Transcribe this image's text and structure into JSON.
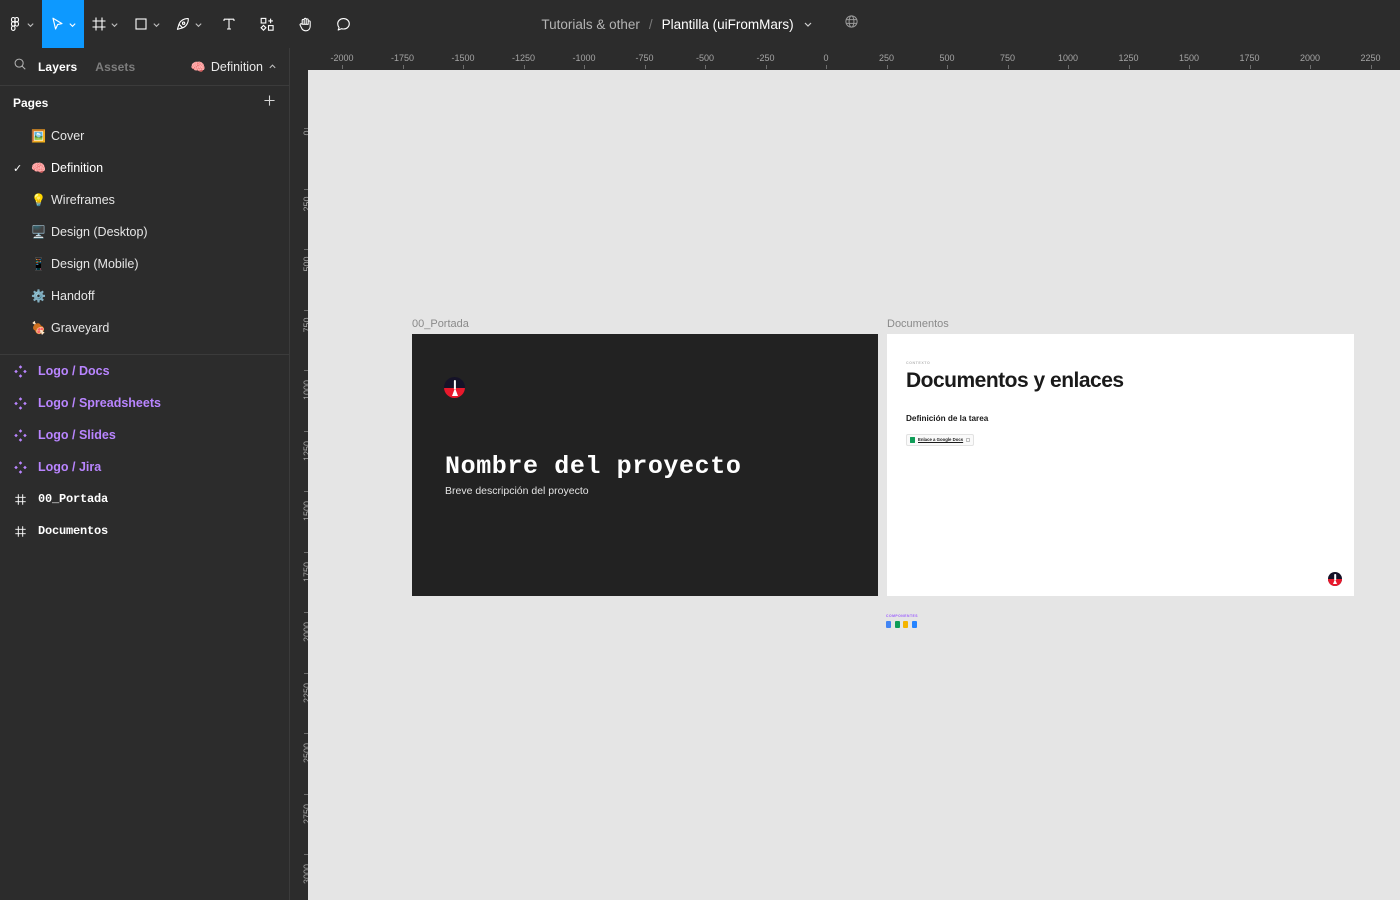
{
  "app": {
    "name": "Figma"
  },
  "toolbar": {
    "tools": [
      {
        "name": "figma-menu-icon",
        "label": "Main menu",
        "caret": true,
        "active": false
      },
      {
        "name": "move-tool-icon",
        "label": "Move",
        "caret": true,
        "active": true
      },
      {
        "name": "frame-tool-icon",
        "label": "Frame",
        "caret": true,
        "active": false
      },
      {
        "name": "shape-tool-icon",
        "label": "Shape",
        "caret": true,
        "active": false
      },
      {
        "name": "pen-tool-icon",
        "label": "Pen",
        "caret": true,
        "active": false
      },
      {
        "name": "text-tool-icon",
        "label": "Text",
        "caret": false,
        "active": false
      },
      {
        "name": "resources-tool-icon",
        "label": "Resources",
        "caret": false,
        "active": false
      },
      {
        "name": "hand-tool-icon",
        "label": "Hand",
        "caret": false,
        "active": false
      },
      {
        "name": "comment-tool-icon",
        "label": "Comment",
        "caret": false,
        "active": false
      }
    ],
    "breadcrumb_parent": "Tutorials & other",
    "breadcrumb_separator": "/",
    "file_name": "Plantilla (uiFromMars)",
    "globe_icon": "globe-icon",
    "accent_color": "#0d99ff"
  },
  "sidebar": {
    "search_icon": "search-icon",
    "tabs": [
      {
        "label": "Layers",
        "active": true
      },
      {
        "label": "Assets",
        "active": false
      }
    ],
    "page_selector": {
      "emoji": "🧠",
      "label": "Definition",
      "caret_icon": "chevron-up-icon"
    },
    "pages_header": {
      "label": "Pages",
      "add_icon": "plus-icon"
    },
    "pages": [
      {
        "emoji": "🖼️",
        "label": "Cover",
        "selected": false
      },
      {
        "emoji": "🧠",
        "label": "Definition",
        "selected": true
      },
      {
        "emoji": "💡",
        "label": "Wireframes",
        "selected": false
      },
      {
        "emoji": "🖥️",
        "label": "Design (Desktop)",
        "selected": false
      },
      {
        "emoji": "📱",
        "label": "Design (Mobile)",
        "selected": false
      },
      {
        "emoji": "⚙️",
        "label": "Handoff",
        "selected": false
      },
      {
        "emoji": "🍖",
        "label": "Graveyard",
        "selected": false
      }
    ],
    "layers": [
      {
        "icon": "component-icon",
        "type": "component",
        "label": "Logo / Docs"
      },
      {
        "icon": "component-icon",
        "type": "component",
        "label": "Logo / Spreadsheets"
      },
      {
        "icon": "component-icon",
        "type": "component",
        "label": "Logo / Slides"
      },
      {
        "icon": "component-icon",
        "type": "component",
        "label": "Logo / Jira"
      },
      {
        "icon": "frame-icon",
        "type": "frame",
        "label": "00_Portada"
      },
      {
        "icon": "frame-icon",
        "type": "frame",
        "label": "Documentos"
      }
    ]
  },
  "rulers": {
    "horizontal": [
      "-2000",
      "-1750",
      "-1500",
      "-1250",
      "-1000",
      "-750",
      "-500",
      "-250",
      "0",
      "250",
      "500",
      "750",
      "1000",
      "1250",
      "1500",
      "1750",
      "2000",
      "2250"
    ],
    "vertical": [
      "0",
      "250",
      "500",
      "750",
      "1000",
      "1250",
      "1500",
      "1750",
      "2000",
      "2250",
      "2500",
      "2750",
      "3000"
    ]
  },
  "canvas": {
    "background_color": "#e5e5e5",
    "frames": [
      {
        "name": "00_Portada",
        "label": "00_Portada",
        "background_color": "#222222",
        "title": "Nombre del proyecto",
        "subtitle": "Breve descripción del proyecto",
        "logo": "project-logo-icon"
      },
      {
        "name": "Documentos",
        "label": "Documentos",
        "background_color": "#ffffff",
        "eyebrow": "CONTEXTO",
        "title": "Documentos y enlaces",
        "section": "Definición de la tarea",
        "link_label": "Enlace a Google Docs",
        "link_icon": "google-docs-icon",
        "copy_icon": "copy-icon",
        "avatar": "project-logo-icon"
      }
    ],
    "mini_cluster": {
      "title": "COMPONENTES",
      "icons": [
        {
          "name": "logo-docs-icon",
          "color": "#4285f4"
        },
        {
          "name": "logo-spreadsheets-icon",
          "color": "#0f9d58"
        },
        {
          "name": "logo-slides-icon",
          "color": "#f4b400"
        },
        {
          "name": "logo-jira-icon",
          "color": "#2684ff"
        }
      ]
    }
  }
}
